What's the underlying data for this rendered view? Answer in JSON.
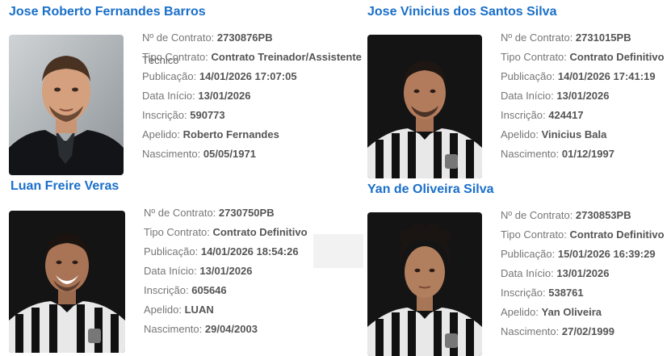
{
  "labels": {
    "contract": "Nº de Contrato:",
    "type": "Tipo Contrato:",
    "publication": "Publicação:",
    "start": "Data Início:",
    "registration": "Inscrição:",
    "nickname": "Apelido:",
    "birth": "Nascimento:"
  },
  "players": [
    {
      "name": "Jose Roberto Fernandes Barros",
      "contract": "2730876PB",
      "type_line1": "Contrato Treinador/Assistente",
      "type_line2": "Técnico",
      "publication": "14/01/2026 17:07:05",
      "start": "13/01/2026",
      "registration": "590773",
      "nickname": "Roberto Fernandes",
      "birth": "05/05/1971"
    },
    {
      "name": "Jose Vinicius dos Santos Silva",
      "contract": "2731015PB",
      "type": "Contrato Definitivo",
      "publication": "14/01/2026 17:41:19",
      "start": "13/01/2026",
      "registration": "424417",
      "nickname": "Vinicius Bala",
      "birth": "01/12/1997"
    },
    {
      "name": "Luan Freire Veras",
      "contract": "2730750PB",
      "type": "Contrato Definitivo",
      "publication": "14/01/2026 18:54:26",
      "start": "13/01/2026",
      "registration": "605646",
      "nickname": "LUAN",
      "birth": "29/04/2003"
    },
    {
      "name": "Yan de Oliveira Silva",
      "contract": "2730853PB",
      "type": "Contrato Definitivo",
      "publication": "15/01/2026 16:39:29",
      "start": "13/01/2026",
      "registration": "538761",
      "nickname": "Yan Oliveira",
      "birth": "27/02/1999"
    }
  ]
}
